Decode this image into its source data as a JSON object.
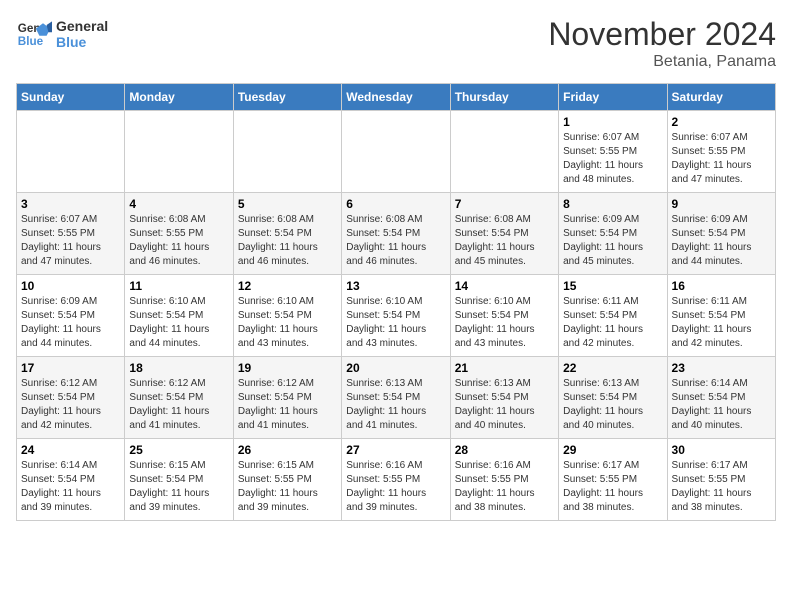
{
  "logo": {
    "line1": "General",
    "line2": "Blue"
  },
  "title": "November 2024",
  "subtitle": "Betania, Panama",
  "days_of_week": [
    "Sunday",
    "Monday",
    "Tuesday",
    "Wednesday",
    "Thursday",
    "Friday",
    "Saturday"
  ],
  "weeks": [
    [
      {
        "day": "",
        "info": ""
      },
      {
        "day": "",
        "info": ""
      },
      {
        "day": "",
        "info": ""
      },
      {
        "day": "",
        "info": ""
      },
      {
        "day": "",
        "info": ""
      },
      {
        "day": "1",
        "info": "Sunrise: 6:07 AM\nSunset: 5:55 PM\nDaylight: 11 hours\nand 48 minutes."
      },
      {
        "day": "2",
        "info": "Sunrise: 6:07 AM\nSunset: 5:55 PM\nDaylight: 11 hours\nand 47 minutes."
      }
    ],
    [
      {
        "day": "3",
        "info": "Sunrise: 6:07 AM\nSunset: 5:55 PM\nDaylight: 11 hours\nand 47 minutes."
      },
      {
        "day": "4",
        "info": "Sunrise: 6:08 AM\nSunset: 5:55 PM\nDaylight: 11 hours\nand 46 minutes."
      },
      {
        "day": "5",
        "info": "Sunrise: 6:08 AM\nSunset: 5:54 PM\nDaylight: 11 hours\nand 46 minutes."
      },
      {
        "day": "6",
        "info": "Sunrise: 6:08 AM\nSunset: 5:54 PM\nDaylight: 11 hours\nand 46 minutes."
      },
      {
        "day": "7",
        "info": "Sunrise: 6:08 AM\nSunset: 5:54 PM\nDaylight: 11 hours\nand 45 minutes."
      },
      {
        "day": "8",
        "info": "Sunrise: 6:09 AM\nSunset: 5:54 PM\nDaylight: 11 hours\nand 45 minutes."
      },
      {
        "day": "9",
        "info": "Sunrise: 6:09 AM\nSunset: 5:54 PM\nDaylight: 11 hours\nand 44 minutes."
      }
    ],
    [
      {
        "day": "10",
        "info": "Sunrise: 6:09 AM\nSunset: 5:54 PM\nDaylight: 11 hours\nand 44 minutes."
      },
      {
        "day": "11",
        "info": "Sunrise: 6:10 AM\nSunset: 5:54 PM\nDaylight: 11 hours\nand 44 minutes."
      },
      {
        "day": "12",
        "info": "Sunrise: 6:10 AM\nSunset: 5:54 PM\nDaylight: 11 hours\nand 43 minutes."
      },
      {
        "day": "13",
        "info": "Sunrise: 6:10 AM\nSunset: 5:54 PM\nDaylight: 11 hours\nand 43 minutes."
      },
      {
        "day": "14",
        "info": "Sunrise: 6:10 AM\nSunset: 5:54 PM\nDaylight: 11 hours\nand 43 minutes."
      },
      {
        "day": "15",
        "info": "Sunrise: 6:11 AM\nSunset: 5:54 PM\nDaylight: 11 hours\nand 42 minutes."
      },
      {
        "day": "16",
        "info": "Sunrise: 6:11 AM\nSunset: 5:54 PM\nDaylight: 11 hours\nand 42 minutes."
      }
    ],
    [
      {
        "day": "17",
        "info": "Sunrise: 6:12 AM\nSunset: 5:54 PM\nDaylight: 11 hours\nand 42 minutes."
      },
      {
        "day": "18",
        "info": "Sunrise: 6:12 AM\nSunset: 5:54 PM\nDaylight: 11 hours\nand 41 minutes."
      },
      {
        "day": "19",
        "info": "Sunrise: 6:12 AM\nSunset: 5:54 PM\nDaylight: 11 hours\nand 41 minutes."
      },
      {
        "day": "20",
        "info": "Sunrise: 6:13 AM\nSunset: 5:54 PM\nDaylight: 11 hours\nand 41 minutes."
      },
      {
        "day": "21",
        "info": "Sunrise: 6:13 AM\nSunset: 5:54 PM\nDaylight: 11 hours\nand 40 minutes."
      },
      {
        "day": "22",
        "info": "Sunrise: 6:13 AM\nSunset: 5:54 PM\nDaylight: 11 hours\nand 40 minutes."
      },
      {
        "day": "23",
        "info": "Sunrise: 6:14 AM\nSunset: 5:54 PM\nDaylight: 11 hours\nand 40 minutes."
      }
    ],
    [
      {
        "day": "24",
        "info": "Sunrise: 6:14 AM\nSunset: 5:54 PM\nDaylight: 11 hours\nand 39 minutes."
      },
      {
        "day": "25",
        "info": "Sunrise: 6:15 AM\nSunset: 5:54 PM\nDaylight: 11 hours\nand 39 minutes."
      },
      {
        "day": "26",
        "info": "Sunrise: 6:15 AM\nSunset: 5:55 PM\nDaylight: 11 hours\nand 39 minutes."
      },
      {
        "day": "27",
        "info": "Sunrise: 6:16 AM\nSunset: 5:55 PM\nDaylight: 11 hours\nand 39 minutes."
      },
      {
        "day": "28",
        "info": "Sunrise: 6:16 AM\nSunset: 5:55 PM\nDaylight: 11 hours\nand 38 minutes."
      },
      {
        "day": "29",
        "info": "Sunrise: 6:17 AM\nSunset: 5:55 PM\nDaylight: 11 hours\nand 38 minutes."
      },
      {
        "day": "30",
        "info": "Sunrise: 6:17 AM\nSunset: 5:55 PM\nDaylight: 11 hours\nand 38 minutes."
      }
    ]
  ]
}
